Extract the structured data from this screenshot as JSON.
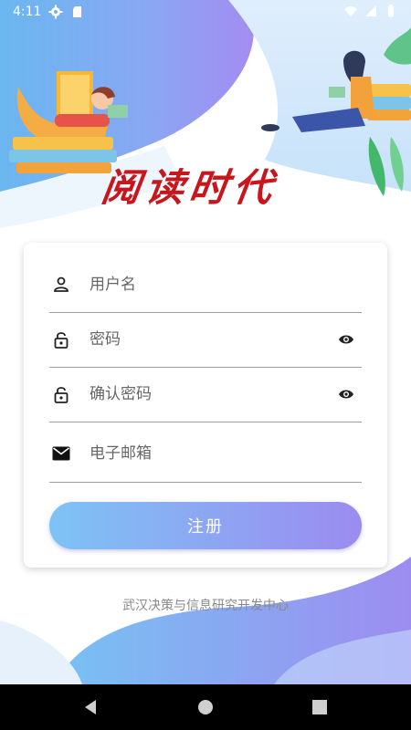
{
  "status_bar": {
    "time": "4:11",
    "icons": [
      "settings-icon",
      "sd-card-icon",
      "wifi-icon",
      "signal-icon",
      "battery-icon"
    ]
  },
  "app": {
    "logo_text": "阅读时代",
    "brand_color": "#c8161d"
  },
  "form": {
    "username_placeholder": "用户名",
    "password_placeholder": "密码",
    "confirm_password_placeholder": "确认密码",
    "email_placeholder": "电子邮箱",
    "register_label": "注册"
  },
  "footer": {
    "org": "武汉决策与信息研究开发中心"
  },
  "nav": {
    "icons": [
      "back-icon",
      "home-icon",
      "recents-icon"
    ]
  },
  "colors": {
    "gradient_start": "#7ec3f5",
    "gradient_end": "#9b8bf0"
  }
}
